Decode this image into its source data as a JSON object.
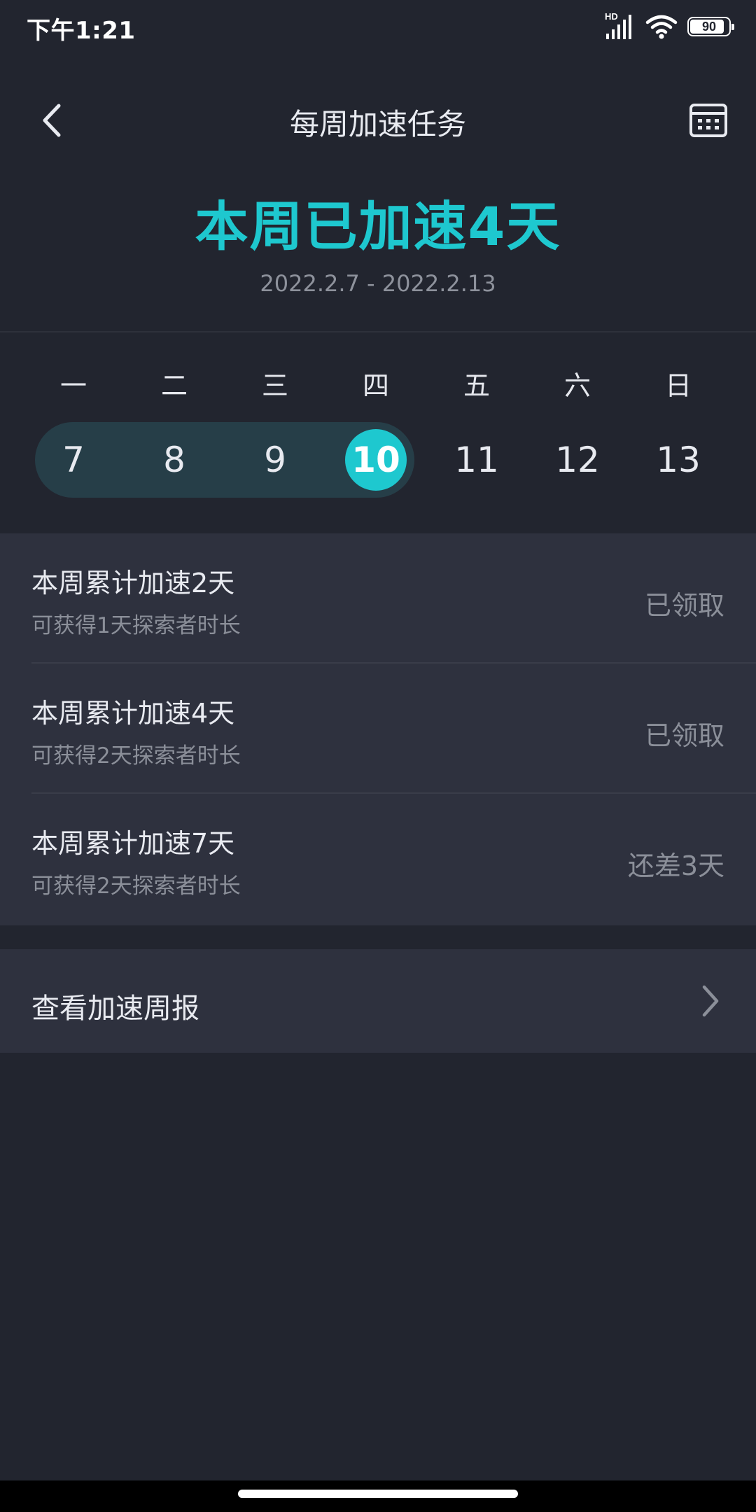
{
  "status_bar": {
    "time": "下午1:21",
    "network_badge": "HD",
    "battery_level": "90",
    "battery_fraction": 0.9
  },
  "nav": {
    "title": "每周加速任务",
    "back_icon": "chevron-left-icon",
    "calendar_icon": "calendar-icon"
  },
  "hero": {
    "title": "本周已加速4天",
    "date_range": "2022.2.7 - 2022.2.13"
  },
  "week": {
    "labels": [
      "一",
      "二",
      "三",
      "四",
      "五",
      "六",
      "日"
    ],
    "days": [
      "7",
      "8",
      "9",
      "10",
      "11",
      "12",
      "13"
    ],
    "accelerated_days": 4,
    "today_index": 3,
    "colors": {
      "accent": "#1ec8cf",
      "pill": "#263e48"
    }
  },
  "tasks": [
    {
      "title": "本周累计加速2天",
      "subtitle": "可获得1天探索者时长",
      "status": "已领取"
    },
    {
      "title": "本周累计加速4天",
      "subtitle": "可获得2天探索者时长",
      "status": "已领取"
    },
    {
      "title": "本周累计加速7天",
      "subtitle": "可获得2天探索者时长",
      "status": "还差3天"
    }
  ],
  "report": {
    "label": "查看加速周报",
    "chevron_icon": "chevron-right-icon"
  }
}
